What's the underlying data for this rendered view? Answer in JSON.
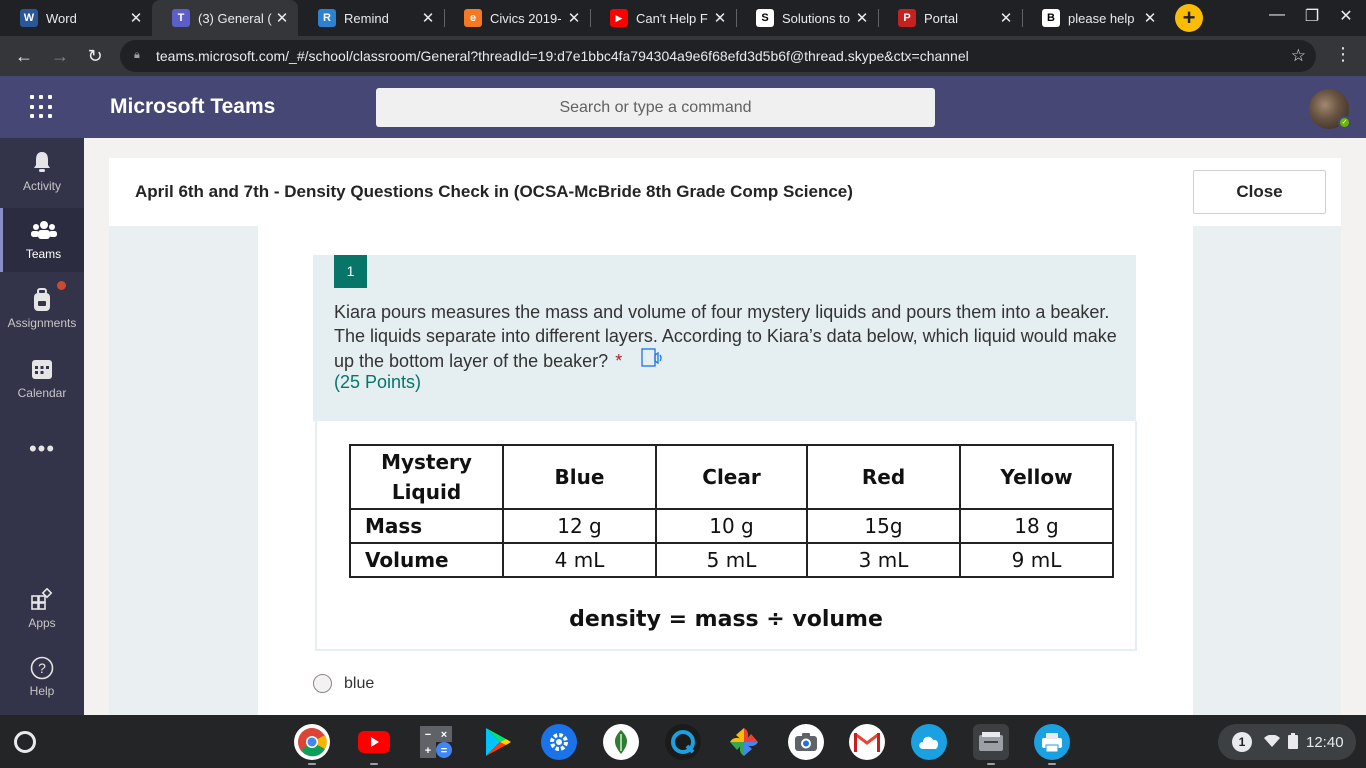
{
  "browser": {
    "tabs": [
      {
        "title": "Word",
        "favicon": "word-icon",
        "color": "#2b579a",
        "glyph": "W"
      },
      {
        "title": "(3) General (",
        "favicon": "teams-icon",
        "color": "#5b5fc7",
        "glyph": "T",
        "active": true
      },
      {
        "title": "Remind",
        "favicon": "remind-icon",
        "color": "#2d82cf",
        "glyph": "R"
      },
      {
        "title": "Civics 2019-",
        "favicon": "edgenuity-icon",
        "color": "#f47920",
        "glyph": "e"
      },
      {
        "title": "Can't Help F",
        "favicon": "youtube-icon",
        "color": "#ff0000",
        "glyph": "▶"
      },
      {
        "title": "Solutions to",
        "favicon": "slader-icon",
        "color": "#000000",
        "glyph": "S"
      },
      {
        "title": "Portal",
        "favicon": "portal-icon",
        "color": "#c5221f",
        "glyph": "P"
      },
      {
        "title": "please help",
        "favicon": "brainly-icon",
        "color": "#000000",
        "glyph": "B"
      }
    ],
    "url": "teams.microsoft.com/_#/school/classroom/General?threadId=19:d7e1bbc4fa794304a9e6f68efd3d5b6f@thread.skype&ctx=channel"
  },
  "teams": {
    "app_title": "Microsoft Teams",
    "search_placeholder": "Search or type a command",
    "rail": [
      {
        "label": "Activity",
        "icon": "bell-icon"
      },
      {
        "label": "Teams",
        "icon": "teams-icon",
        "selected": true
      },
      {
        "label": "Assignments",
        "icon": "backpack-icon"
      },
      {
        "label": "Calendar",
        "icon": "calendar-icon"
      },
      {
        "label": "Apps",
        "icon": "apps-icon"
      },
      {
        "label": "Help",
        "icon": "help-icon"
      }
    ]
  },
  "assignment": {
    "title": "April 6th and 7th - Density Questions Check in (OCSA-McBride 8th Grade Comp Science)",
    "close_label": "Close"
  },
  "question": {
    "number": "1",
    "text": "Kiara pours measures the mass and volume of four mystery liquids and pours them into a beaker. The liquids separate into different layers. According to Kiara’s data below, which liquid would make up the bottom layer of the beaker?",
    "required_mark": "*",
    "points": "(25 Points)",
    "table": {
      "headers": [
        "Mystery Liquid",
        "Blue",
        "Clear",
        "Red",
        "Yellow"
      ],
      "rows": [
        {
          "label": "Mass",
          "values": [
            "12 g",
            "10 g",
            "15g",
            "18 g"
          ]
        },
        {
          "label": "Volume",
          "values": [
            "4 mL",
            "5 mL",
            "3 mL",
            "9 mL"
          ]
        }
      ]
    },
    "formula": "density = mass ÷ volume",
    "options": [
      "blue"
    ]
  },
  "shelf": {
    "apps": [
      {
        "name": "chrome-icon",
        "color": "#ffffff"
      },
      {
        "name": "youtube-icon",
        "color": "#ff0000"
      },
      {
        "name": "calculator-icon",
        "color": "#3c4043"
      },
      {
        "name": "play-store-icon",
        "color": "#ffffff"
      },
      {
        "name": "settings-icon",
        "color": "#1a73e8"
      },
      {
        "name": "snapseed-icon",
        "color": "#ffffff"
      },
      {
        "name": "quik-icon",
        "color": "#1ba0e2"
      },
      {
        "name": "photos-icon",
        "color": "#242526"
      },
      {
        "name": "camera-icon",
        "color": "#ffffff"
      },
      {
        "name": "gmail-icon",
        "color": "#ffffff"
      },
      {
        "name": "cloud-app-icon",
        "color": "#1ba0e2"
      },
      {
        "name": "files-icon",
        "color": "#3c4043"
      },
      {
        "name": "printer-app-icon",
        "color": "#1ba0e2"
      }
    ],
    "notification_count": "1",
    "time": "12:40"
  }
}
